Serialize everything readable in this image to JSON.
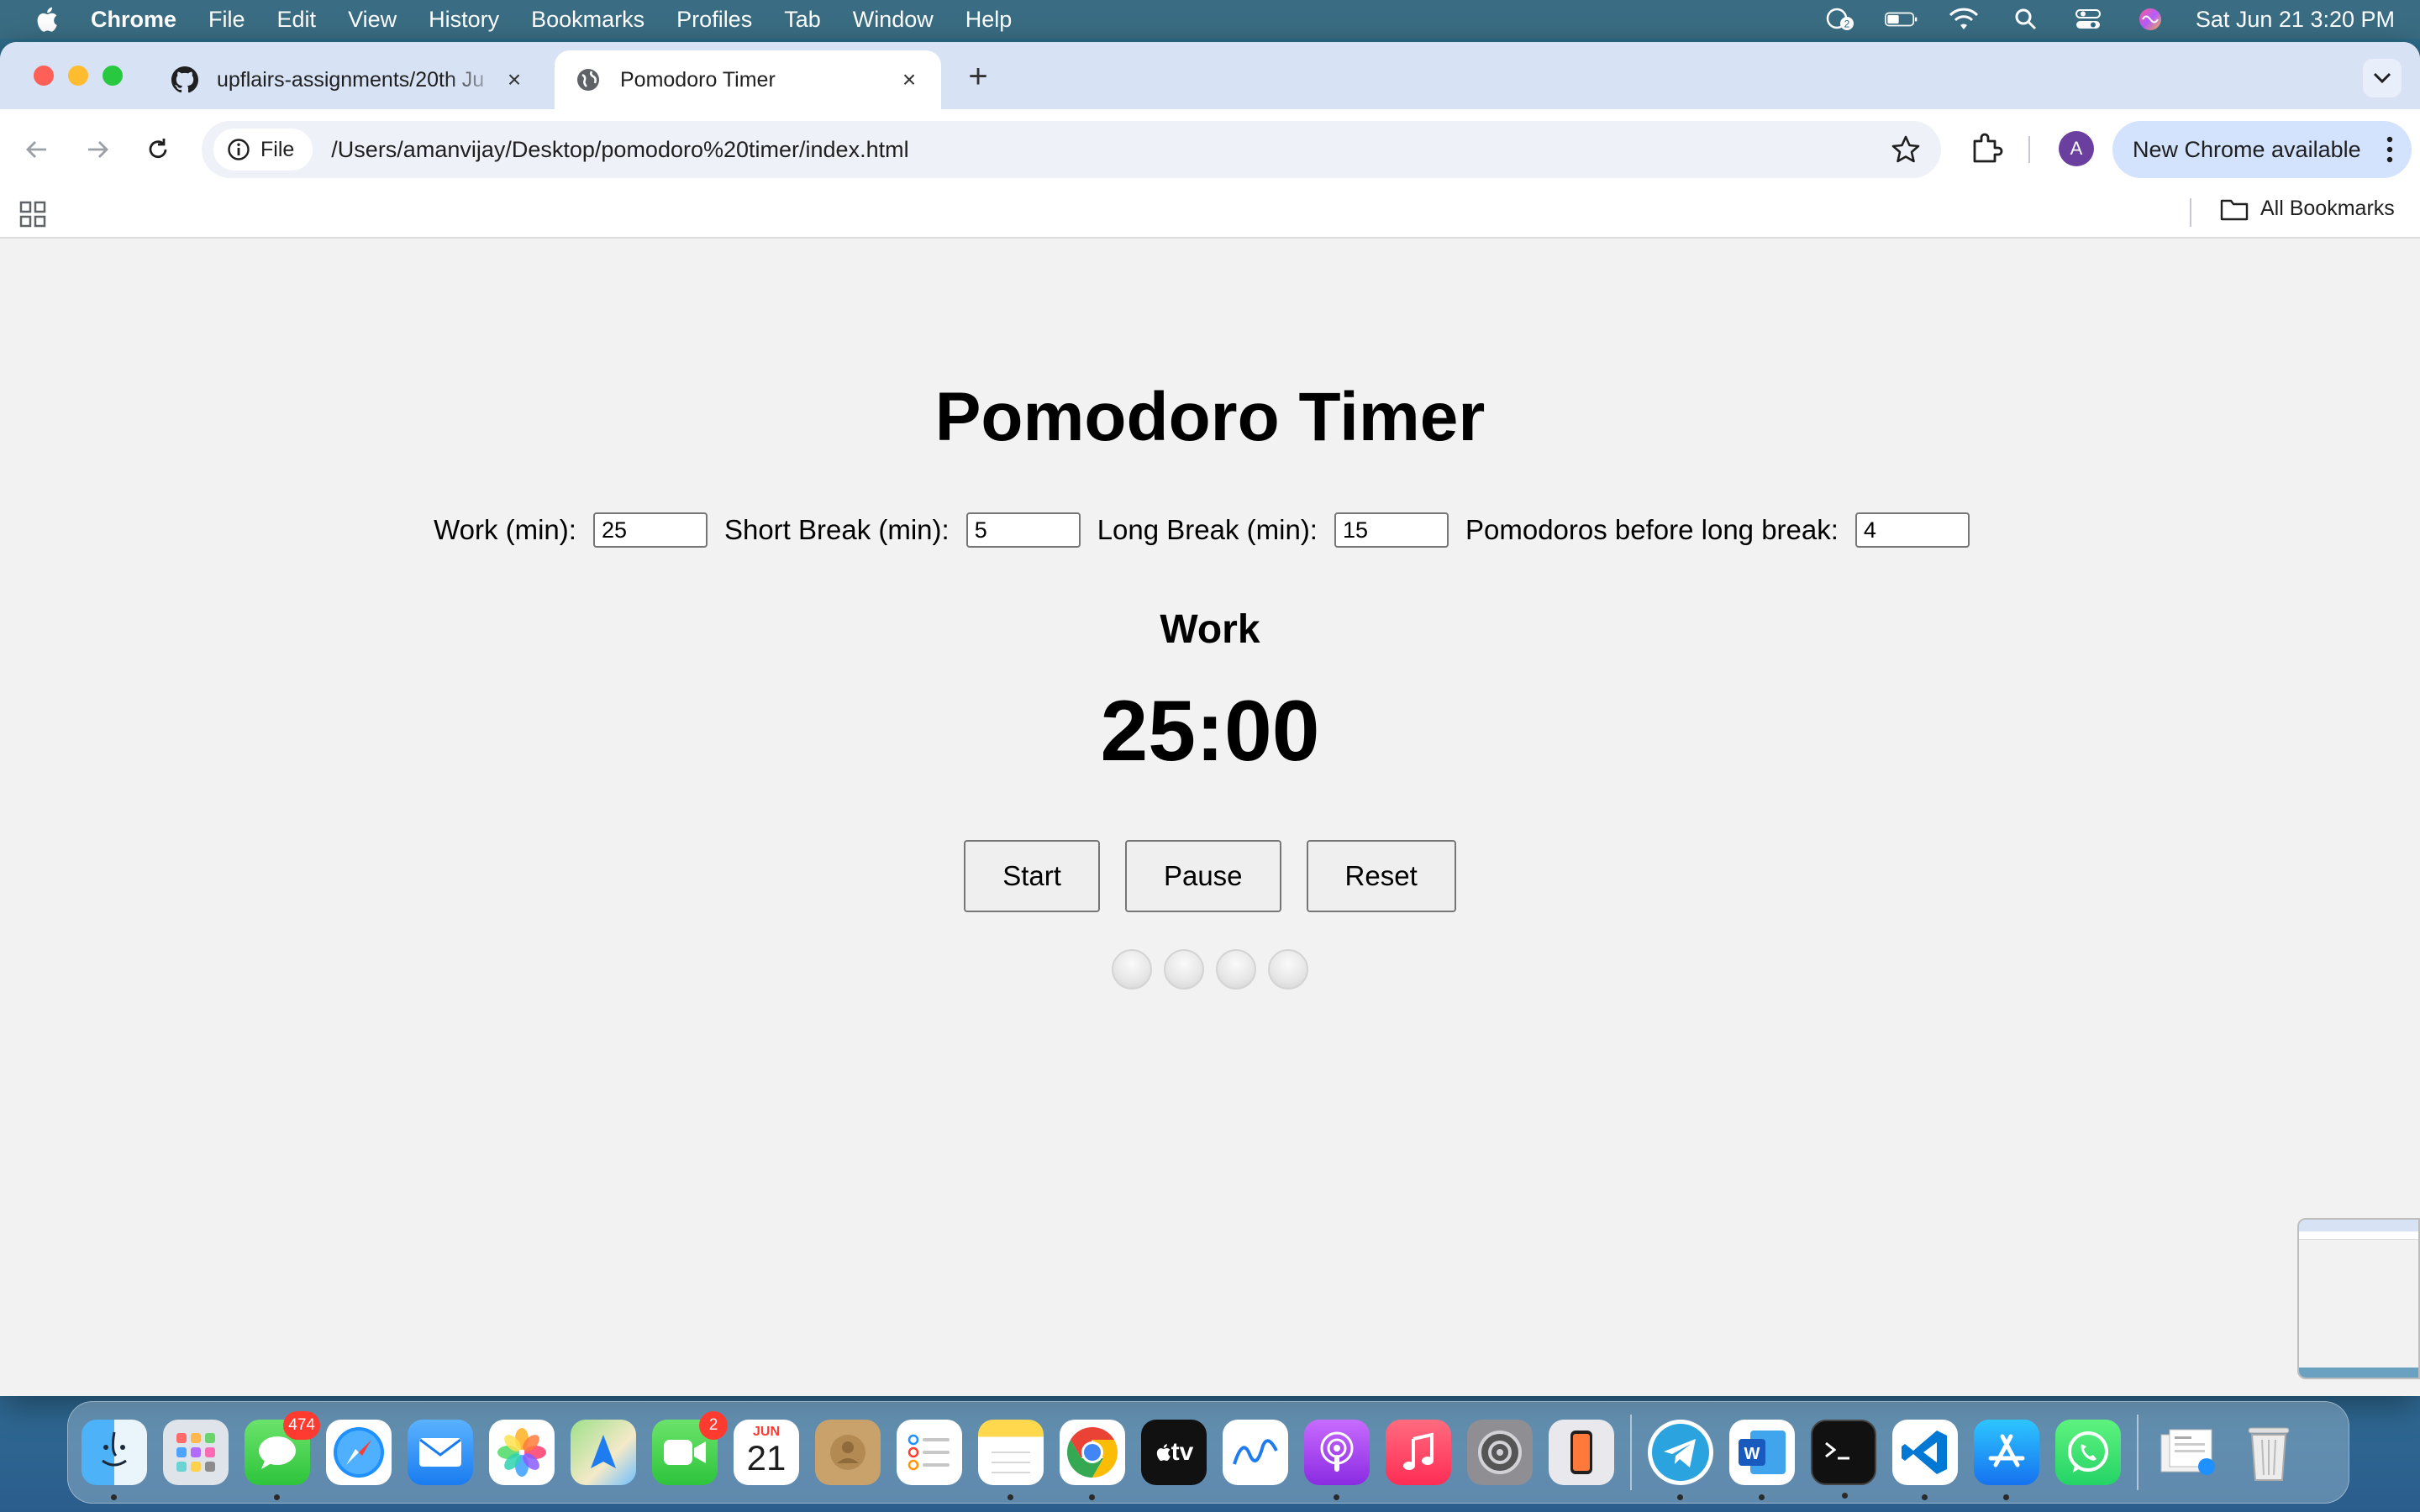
{
  "menubar": {
    "app_name": "Chrome",
    "items": [
      "File",
      "Edit",
      "View",
      "History",
      "Bookmarks",
      "Profiles",
      "Tab",
      "Window",
      "Help"
    ],
    "notification_count": "2",
    "clock": "Sat Jun 21  3:20 PM"
  },
  "browser": {
    "tabs": [
      {
        "title": "upflairs-assignments/20th Ju",
        "icon": "github-icon",
        "active": false
      },
      {
        "title": "Pomodoro Timer",
        "icon": "globe-icon",
        "active": true
      }
    ],
    "file_chip": "File",
    "url": "/Users/amanvijay/Desktop/pomodoro%20timer/index.html",
    "profile_initial": "A",
    "update_button": "New Chrome available",
    "all_bookmarks": "All Bookmarks"
  },
  "page": {
    "title": "Pomodoro Timer",
    "settings": {
      "work_label": "Work (min):",
      "work_value": "25",
      "short_break_label": "Short Break (min):",
      "short_break_value": "5",
      "long_break_label": "Long Break (min):",
      "long_break_value": "15",
      "pomodoros_label": "Pomodoros before long break:",
      "pomodoros_value": "4"
    },
    "mode": "Work",
    "time": "25:00",
    "buttons": {
      "start": "Start",
      "pause": "Pause",
      "reset": "Reset"
    },
    "pomodoros_completed": 0,
    "pomodoros_total": 4
  },
  "dock": {
    "messages_badge": "474",
    "facetime_badge": "2",
    "calendar_month": "JUN",
    "calendar_day": "21",
    "tv_label": "tv"
  },
  "colors": {
    "tabbar": "#d8e2f5",
    "update_button": "#d3e3fd",
    "page_bg": "#f2f2f2",
    "badge": "#ff3b30"
  }
}
